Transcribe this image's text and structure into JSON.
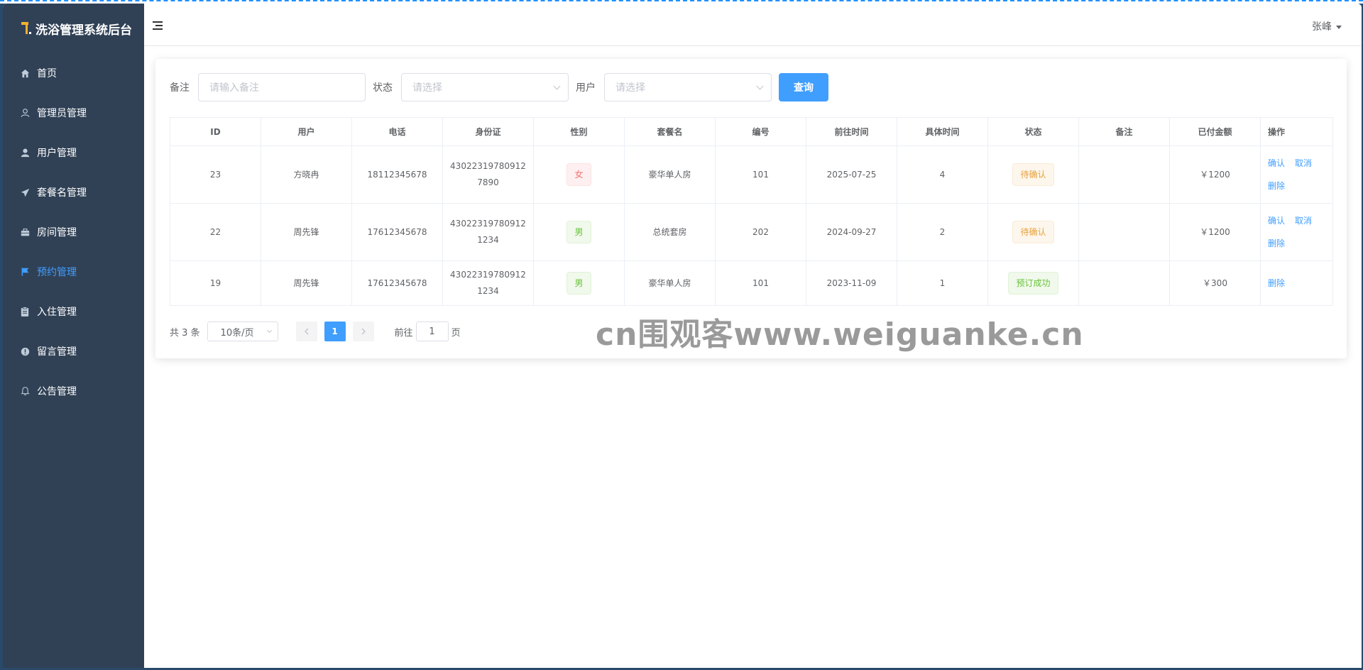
{
  "app": {
    "title": "洗浴管理系统后台"
  },
  "sidebar": {
    "items": [
      {
        "label": "首页",
        "icon": "home-icon",
        "active": false
      },
      {
        "label": "管理员管理",
        "icon": "user-outline-icon",
        "active": false
      },
      {
        "label": "用户管理",
        "icon": "user-solid-icon",
        "active": false
      },
      {
        "label": "套餐名管理",
        "icon": "send-icon",
        "active": false
      },
      {
        "label": "房间管理",
        "icon": "briefcase-icon",
        "active": false
      },
      {
        "label": "预约管理",
        "icon": "flag-icon",
        "active": true
      },
      {
        "label": "入住管理",
        "icon": "clipboard-icon",
        "active": false
      },
      {
        "label": "留言管理",
        "icon": "warning-icon",
        "active": false
      },
      {
        "label": "公告管理",
        "icon": "bell-icon",
        "active": false
      }
    ]
  },
  "header": {
    "username": "张峰"
  },
  "filters": {
    "remark_label": "备注",
    "remark_placeholder": "请输入备注",
    "status_label": "状态",
    "status_placeholder": "请选择",
    "user_label": "用户",
    "user_placeholder": "请选择",
    "query_button": "查询"
  },
  "table": {
    "headers": [
      "ID",
      "用户",
      "电话",
      "身份证",
      "性别",
      "套餐名",
      "编号",
      "前往时间",
      "具体时间",
      "状态",
      "备注",
      "已付金额",
      "操作"
    ],
    "rows": [
      {
        "id": "23",
        "user": "方晓冉",
        "phone": "18112345678",
        "idcard": "430223197809127890",
        "gender": "女",
        "package": "豪华单人房",
        "number": "101",
        "date": "2025-07-25",
        "time": "4",
        "status": "待确认",
        "remark": "",
        "paid": "￥1200",
        "ops": [
          "确认",
          "取消",
          "删除"
        ]
      },
      {
        "id": "22",
        "user": "周先锋",
        "phone": "17612345678",
        "idcard": "430223197809121234",
        "gender": "男",
        "package": "总统套房",
        "number": "202",
        "date": "2024-09-27",
        "time": "2",
        "status": "待确认",
        "remark": "",
        "paid": "￥1200",
        "ops": [
          "确认",
          "取消",
          "删除"
        ]
      },
      {
        "id": "19",
        "user": "周先锋",
        "phone": "17612345678",
        "idcard": "430223197809121234",
        "gender": "男",
        "package": "豪华单人房",
        "number": "101",
        "date": "2023-11-09",
        "time": "1",
        "status": "预订成功",
        "remark": "",
        "paid": "￥300",
        "ops": [
          "删除"
        ]
      }
    ]
  },
  "pagination": {
    "total_text": "共 3 条",
    "page_size": "10条/页",
    "current_page": "1",
    "prev_icon": "chevron-left-icon",
    "next_icon": "chevron-right-icon",
    "goto_label": "前往",
    "goto_value": "1",
    "goto_suffix": "页"
  },
  "watermark": "cn围观客www.weiguanke.cn",
  "colors": {
    "sidebar_bg": "#304156",
    "accent": "#409eff",
    "danger": "#f56c6c",
    "success": "#67c23a",
    "warning": "#e6a23c"
  }
}
